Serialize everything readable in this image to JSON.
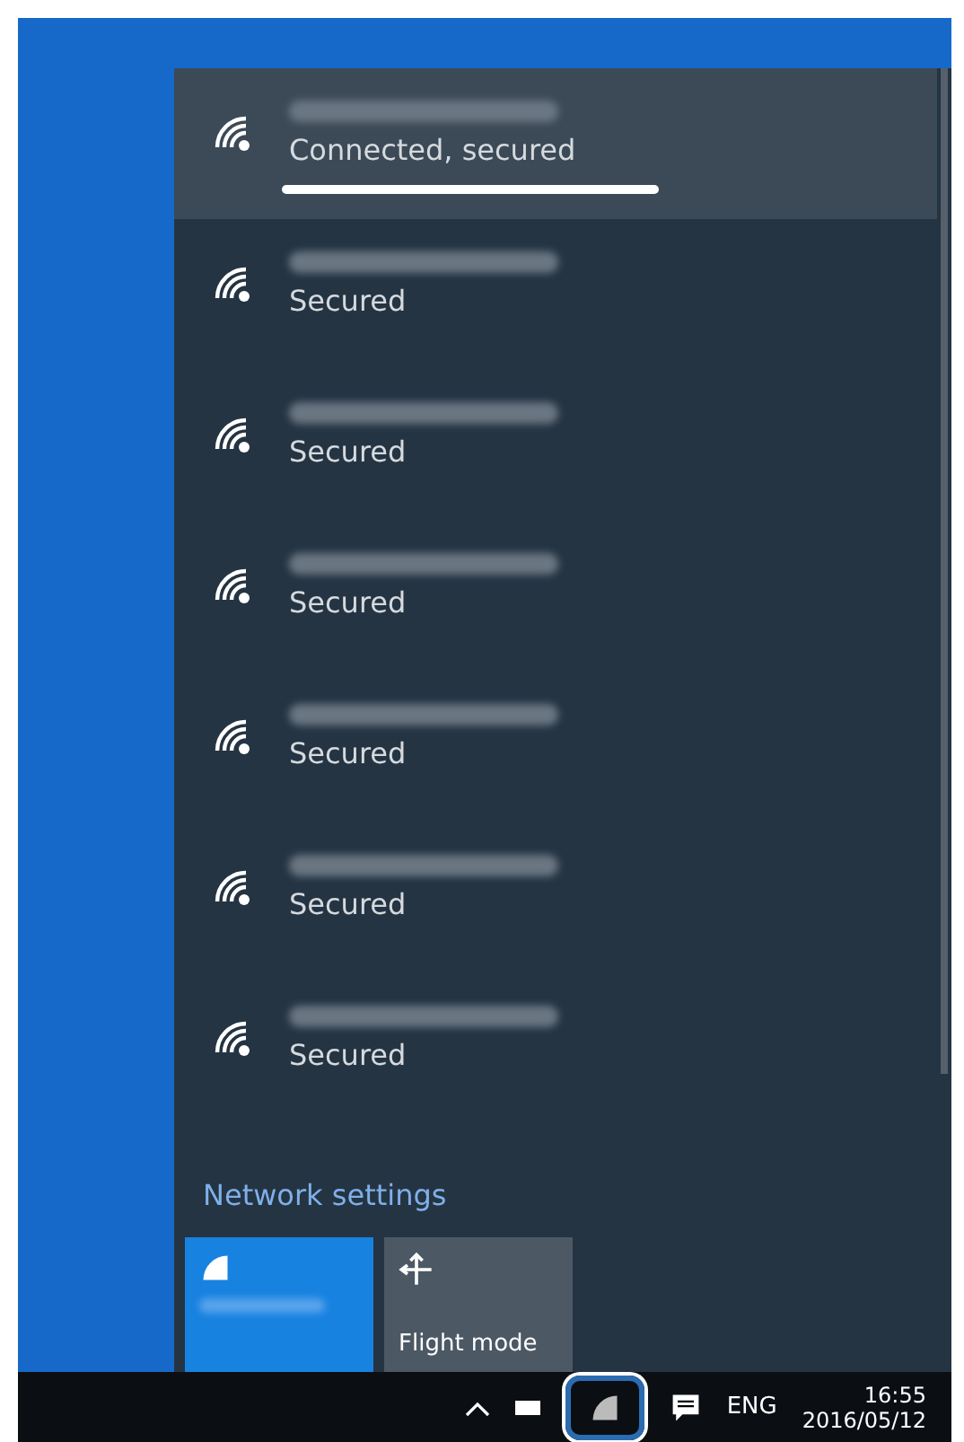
{
  "networks": [
    {
      "status": "Connected, secured",
      "selected": true,
      "underlined": true
    },
    {
      "status": "Secured",
      "selected": false,
      "underlined": false
    },
    {
      "status": "Secured",
      "selected": false,
      "underlined": false
    },
    {
      "status": "Secured",
      "selected": false,
      "underlined": false
    },
    {
      "status": "Secured",
      "selected": false,
      "underlined": false
    },
    {
      "status": "Secured",
      "selected": false,
      "underlined": false
    },
    {
      "status": "Secured",
      "selected": false,
      "underlined": false
    }
  ],
  "settings_link": "Network settings",
  "tiles": [
    {
      "kind": "wifi",
      "on": true
    },
    {
      "kind": "flight",
      "label": "Flight mode",
      "on": false
    }
  ],
  "taskbar": {
    "language": "ENG",
    "time": "16:55",
    "date": "2016/05/12",
    "network_icon_highlighted": true
  }
}
